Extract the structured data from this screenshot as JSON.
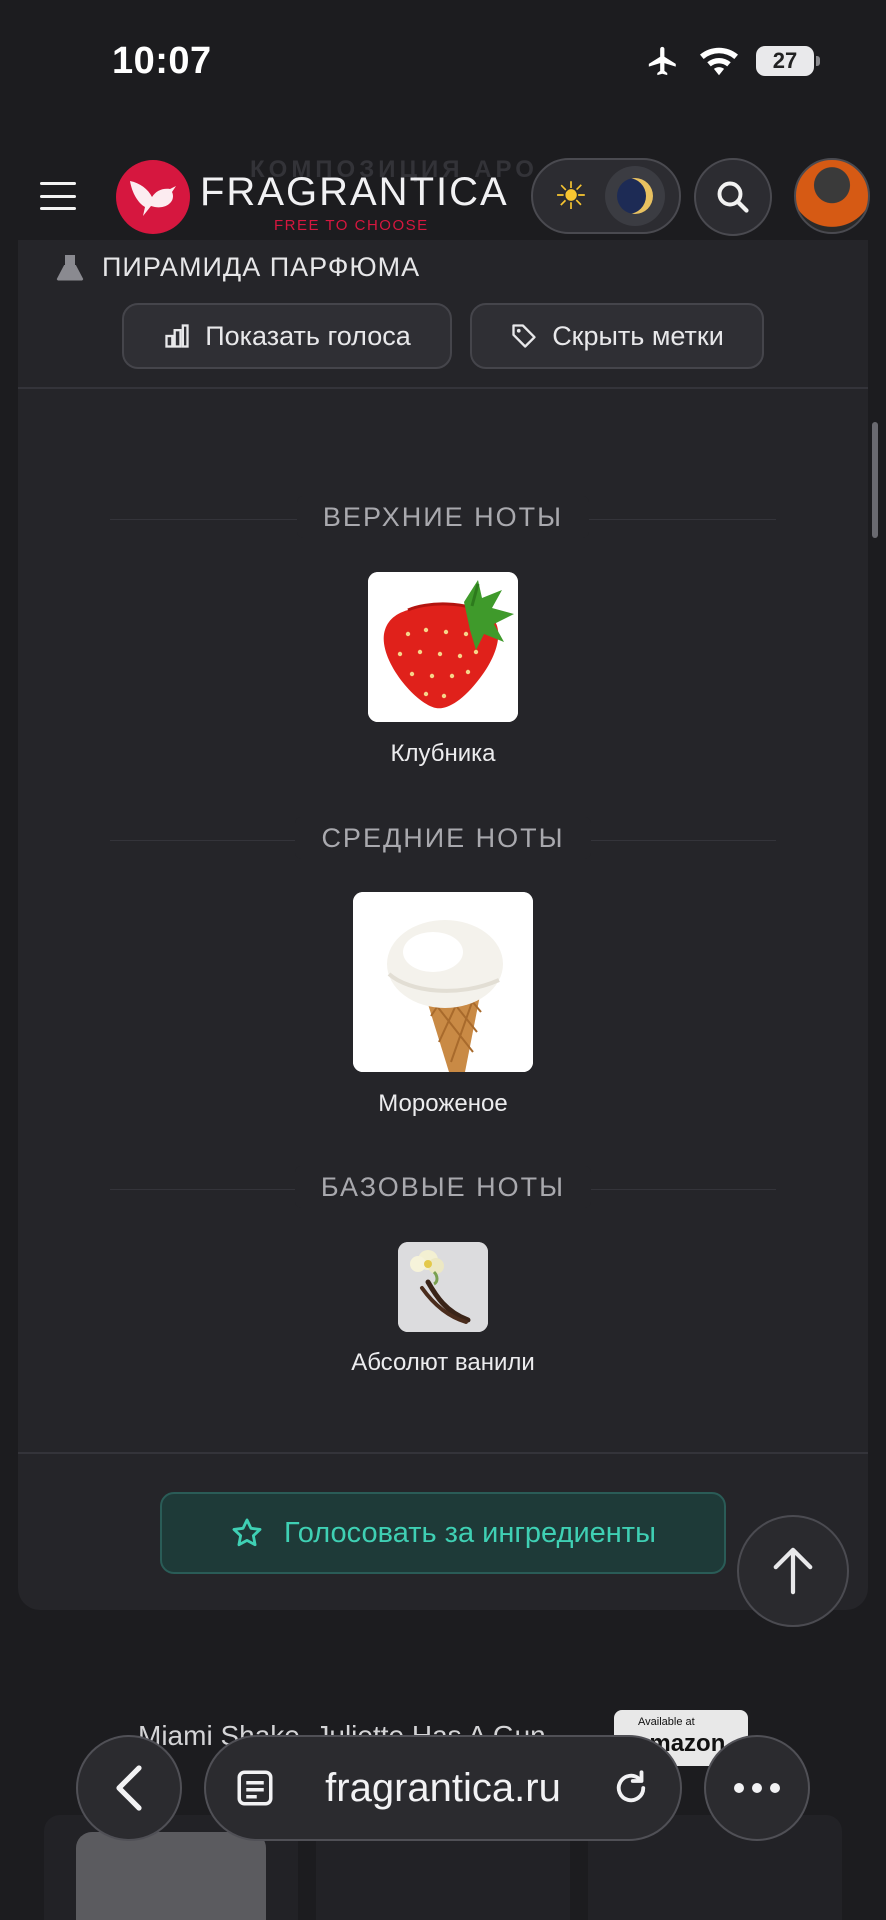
{
  "status_bar": {
    "time": "10:07",
    "battery": "27",
    "icons": [
      "airplane-icon",
      "wifi-icon",
      "battery-icon"
    ]
  },
  "header": {
    "faded_heading": "КОМПОЗИЦИЯ АРО",
    "logo_text": "FRAGRANTICA",
    "logo_tagline": "FREE TO CHOOSE",
    "brand_color": "#d6173f"
  },
  "pyramid": {
    "title": "ПИРАМИДА ПАРФЮМА",
    "show_votes_label": "Показать голоса",
    "hide_tags_label": "Скрыть метки",
    "sections": [
      {
        "label": "ВЕРХНИЕ НОТЫ",
        "note": "Клубника",
        "image": "strawberry"
      },
      {
        "label": "СРЕДНИЕ НОТЫ",
        "note": "Мороженое",
        "image": "ice-cream-cone"
      },
      {
        "label": "БАЗОВЫЕ НОТЫ",
        "note": "Абсолют ванили",
        "image": "vanilla-flower"
      }
    ],
    "vote_label": "Голосовать за ингредиенты",
    "accent_color": "#3fd0b4"
  },
  "below": {
    "product_title": "Miami Shake, Juliette Has A Gun",
    "amazon_small": "Available at",
    "amazon_big": "amazon"
  },
  "browser": {
    "url": "fragrantica.ru"
  }
}
